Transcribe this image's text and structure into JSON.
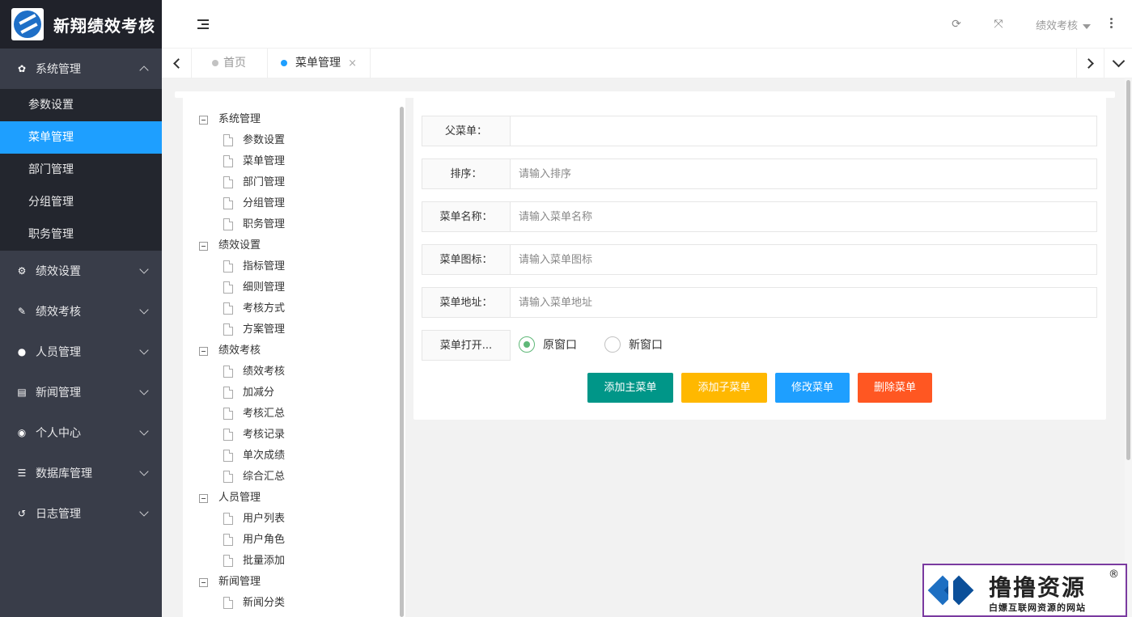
{
  "app": {
    "title": "新翔绩效考核"
  },
  "sidebar": {
    "groups": [
      {
        "label": "系统管理",
        "icon": "gear-icon",
        "open": true,
        "children": [
          "参数设置",
          "菜单管理",
          "部门管理",
          "分组管理",
          "职务管理"
        ],
        "active_child": "菜单管理"
      },
      {
        "label": "绩效设置",
        "icon": "gears-icon"
      },
      {
        "label": "绩效考核",
        "icon": "edit-icon"
      },
      {
        "label": "人员管理",
        "icon": "user-icon"
      },
      {
        "label": "新闻管理",
        "icon": "news-icon"
      },
      {
        "label": "个人中心",
        "icon": "user-circle-icon"
      },
      {
        "label": "数据库管理",
        "icon": "database-icon"
      },
      {
        "label": "日志管理",
        "icon": "history-icon"
      }
    ]
  },
  "header": {
    "user_menu": "绩效考核",
    "icons": [
      "refresh-icon",
      "fullscreen-icon",
      "more-icon"
    ]
  },
  "tabs": [
    {
      "label": "首页",
      "active": false,
      "dot_color": "#c2c2c2"
    },
    {
      "label": "菜单管理",
      "active": true,
      "dot_color": "#1e9fff",
      "close": "×"
    }
  ],
  "tree": [
    {
      "label": "系统管理",
      "children": [
        "参数设置",
        "菜单管理",
        "部门管理",
        "分组管理",
        "职务管理"
      ]
    },
    {
      "label": "绩效设置",
      "children": [
        "指标管理",
        "细则管理",
        "考核方式",
        "方案管理"
      ]
    },
    {
      "label": "绩效考核",
      "children": [
        "绩效考核",
        "加减分",
        "考核汇总",
        "考核记录",
        "单次成绩",
        "综合汇总"
      ]
    },
    {
      "label": "人员管理",
      "children": [
        "用户列表",
        "用户角色",
        "批量添加"
      ]
    },
    {
      "label": "新闻管理",
      "children": [
        "新闻分类"
      ]
    }
  ],
  "form": {
    "parent": {
      "label": "父菜单：",
      "value": ""
    },
    "sort": {
      "label": "排序：",
      "placeholder": "请输入排序"
    },
    "name": {
      "label": "菜单名称：",
      "placeholder": "请输入菜单名称"
    },
    "icon": {
      "label": "菜单图标：",
      "placeholder": "请输入菜单图标"
    },
    "url": {
      "label": "菜单地址：",
      "placeholder": "请输入菜单地址"
    },
    "open_mode": {
      "label": "菜单打开...",
      "options": [
        "原窗口",
        "新窗口"
      ],
      "selected": "原窗口"
    }
  },
  "buttons": [
    {
      "label": "添加主菜单",
      "color": "#009688"
    },
    {
      "label": "添加子菜单",
      "color": "#ffb800"
    },
    {
      "label": "修改菜单",
      "color": "#1e9fff"
    },
    {
      "label": "删除菜单",
      "color": "#ff5722"
    }
  ],
  "watermark": {
    "title": "撸撸资源",
    "subtitle": "白嫖互联网资源的网站",
    "reg": "®"
  }
}
